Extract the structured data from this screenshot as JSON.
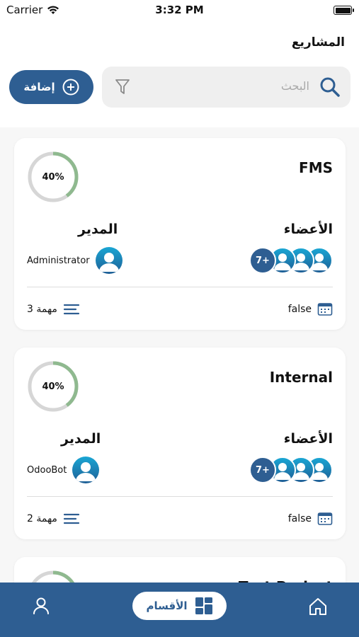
{
  "status_bar": {
    "carrier": "Carrier",
    "time": "3:32 PM"
  },
  "header": {
    "title": "المشاريع",
    "search_placeholder": "البحث",
    "add_label": "إضافة"
  },
  "projects": [
    {
      "name": "FMS",
      "progress_label": "40%",
      "progress": 0.4,
      "members_label": "الأعضاء",
      "members_more": "7+",
      "manager_label": "المدير",
      "manager_name": "Administrator",
      "tasks_label": "3 مهمة",
      "date_label": "false"
    },
    {
      "name": "Internal",
      "progress_label": "40%",
      "progress": 0.4,
      "members_label": "الأعضاء",
      "members_more": "7+",
      "manager_label": "المدير",
      "manager_name": "OdooBot",
      "tasks_label": "2 مهمة",
      "date_label": "false"
    },
    {
      "name": "Test Project"
    }
  ],
  "bottom_nav": {
    "sections_label": "الأقسام"
  },
  "colors": {
    "primary": "#2e5e92",
    "progress_fill": "#8fb98f",
    "progress_track": "#d6d6d6"
  },
  "icons": [
    "wifi-icon",
    "search-icon",
    "filter-icon",
    "plus-circle-icon",
    "user-avatar-icon",
    "list-icon",
    "calendar-icon",
    "profile-icon",
    "grid-icon",
    "home-icon"
  ]
}
